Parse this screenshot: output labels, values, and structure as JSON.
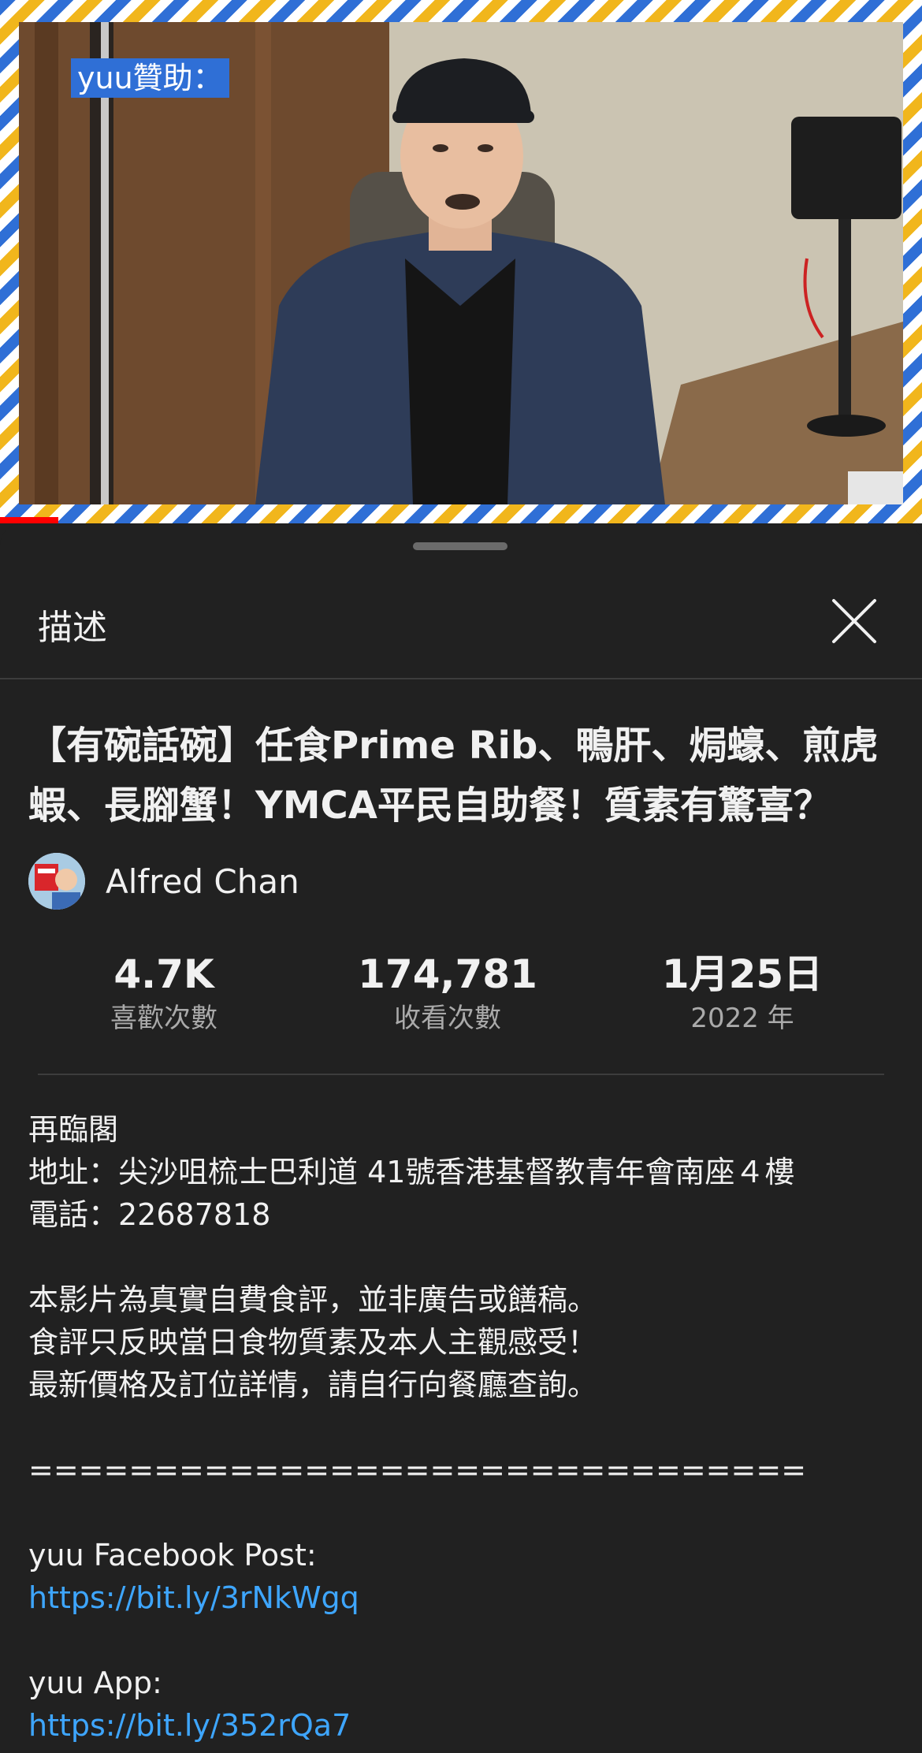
{
  "video": {
    "overlay_text": "yuu贊助："
  },
  "sheet": {
    "title": "描述",
    "close_icon": "close-icon"
  },
  "video_info": {
    "title": "【有碗話碗】任食Prime Rib、鴨肝、焗蠔、煎虎蝦、長腳蟹！YMCA平民自助餐！質素有驚喜？",
    "channel_name": "Alfred Chan"
  },
  "stats": {
    "likes_value": "4.7K",
    "likes_label": "喜歡次數",
    "views_value": "174,781",
    "views_label": "收看次數",
    "date_value": "1月25日",
    "date_year": "2022 年"
  },
  "description": {
    "line1": "再臨閣",
    "line2": "地址：尖沙咀梳士巴利道 41號香港基督教青年會南座４樓",
    "line3": "電話：22687818",
    "line4": "本影片為真實自費食評，並非廣告或饍稿。",
    "line5": "食評只反映當日食物質素及本人主觀感受！",
    "line6": "最新價格及訂位詳情，請自行向餐廳查詢。",
    "separator": "===============================",
    "facebook_label": "yuu Facebook Post:",
    "facebook_link": "https://bit.ly/3rNkWgq",
    "app_label": "yuu App:",
    "app_link": "https://bit.ly/352rQa7"
  },
  "colors": {
    "background": "#212121",
    "link": "#3ea6ff",
    "progress": "#ff0000",
    "overlay_tag": "#2f6fd6"
  }
}
